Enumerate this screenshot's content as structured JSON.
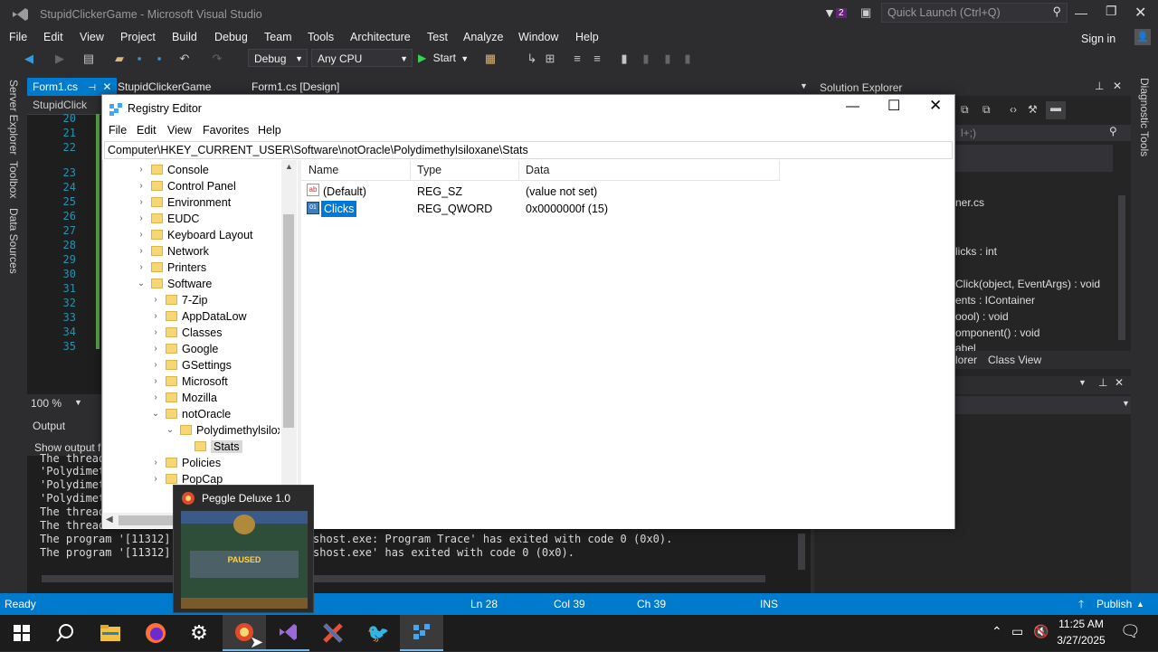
{
  "vs": {
    "title": "StupidClickerGame - Microsoft Visual Studio",
    "notif_count": "2",
    "quick_launch_placeholder": "Quick Launch (Ctrl+Q)",
    "sign_in": "Sign in",
    "menu": [
      "File",
      "Edit",
      "View",
      "Project",
      "Build",
      "Debug",
      "Team",
      "Tools",
      "Architecture",
      "Test",
      "Analyze",
      "Window",
      "Help"
    ],
    "config": "Debug",
    "platform": "Any CPU",
    "start": "Start",
    "tabs": [
      "Form1.cs",
      "StupidClickerGame",
      "Form1.cs [Design]"
    ],
    "nav_left": "StupidClick",
    "line_numbers": [
      "20",
      "21",
      "22",
      "23",
      "24",
      "25",
      "26",
      "27",
      "28",
      "29",
      "30",
      "31",
      "32",
      "33",
      "34",
      "35"
    ],
    "zoom": "100 %",
    "left_rail": [
      "Server Explorer",
      "Toolbox",
      "Data Sources"
    ],
    "right_rail": [
      "Diagnostic Tools"
    ]
  },
  "output": {
    "title": "Output",
    "show_output": "Show output f",
    "lines": [
      "The thread",
      "'Polydimet",
      "'Polydimet",
      "'Polydimet",
      "The thread",
      "The thread",
      "The program '[11312]",
      "The program '[11312]"
    ],
    "right_lines": [
      "shost.exe: Program Trace' has exited with code 0 (0x0).",
      "shost.exe' has exited with code 0 (0x0)."
    ]
  },
  "solution_explorer": {
    "title": "Solution Explorer",
    "search_hint": "l+;)",
    "items": [
      "ner.cs",
      "licks : int",
      "Click(object, EventArgs) : void",
      "ents : IContainer",
      "oool) : void",
      "omponent() : void",
      "abel"
    ],
    "tabs": [
      "lorer",
      "Class View"
    ]
  },
  "status": {
    "ready": "Ready",
    "ln": "Ln 28",
    "col": "Col 39",
    "ch": "Ch 39",
    "ins": "INS",
    "publish": "Publish"
  },
  "taskbar": {
    "time": "11:25 AM",
    "date": "3/27/2025",
    "apps": [
      "windows-start",
      "search",
      "file-explorer",
      "firefox",
      "settings",
      "peggle",
      "visual-studio",
      "app-x",
      "app-bird",
      "registry-editor"
    ]
  },
  "regedit": {
    "title": "Registry Editor",
    "menu": [
      "File",
      "Edit",
      "View",
      "Favorites",
      "Help"
    ],
    "address": "Computer\\HKEY_CURRENT_USER\\Software\\notOracle\\Polydimethylsiloxane\\Stats",
    "tree": [
      {
        "label": "Console",
        "level": 1
      },
      {
        "label": "Control Panel",
        "level": 1
      },
      {
        "label": "Environment",
        "level": 1
      },
      {
        "label": "EUDC",
        "level": 1
      },
      {
        "label": "Keyboard Layout",
        "level": 1
      },
      {
        "label": "Network",
        "level": 1
      },
      {
        "label": "Printers",
        "level": 1
      },
      {
        "label": "Software",
        "level": 1,
        "expanded": true
      },
      {
        "label": "7-Zip",
        "level": 2
      },
      {
        "label": "AppDataLow",
        "level": 2
      },
      {
        "label": "Classes",
        "level": 2
      },
      {
        "label": "Google",
        "level": 2
      },
      {
        "label": "GSettings",
        "level": 2
      },
      {
        "label": "Microsoft",
        "level": 2
      },
      {
        "label": "Mozilla",
        "level": 2
      },
      {
        "label": "notOracle",
        "level": 2,
        "expanded": true
      },
      {
        "label": "Polydimethylsilox",
        "level": 3,
        "expanded": true
      },
      {
        "label": "Stats",
        "level": 4,
        "selected": true
      },
      {
        "label": "Policies",
        "level": 2
      },
      {
        "label": "PopCap",
        "level": 2
      }
    ],
    "columns": [
      "Name",
      "Type",
      "Data"
    ],
    "values": [
      {
        "name": "(Default)",
        "type": "REG_SZ",
        "data": "(value not set)",
        "icon": "string-value-icon"
      },
      {
        "name": "Clicks",
        "type": "REG_QWORD",
        "data": "0x0000000f (15)",
        "icon": "binary-value-icon",
        "selected": true
      }
    ]
  },
  "peggle": {
    "title": "Peggle Deluxe 1.0",
    "paused": "PAUSED"
  },
  "colors": {
    "vs_bg": "#2d2d30",
    "editor_bg": "#1e1e1e",
    "accent": "#007acc",
    "selection": "#0078d7"
  }
}
